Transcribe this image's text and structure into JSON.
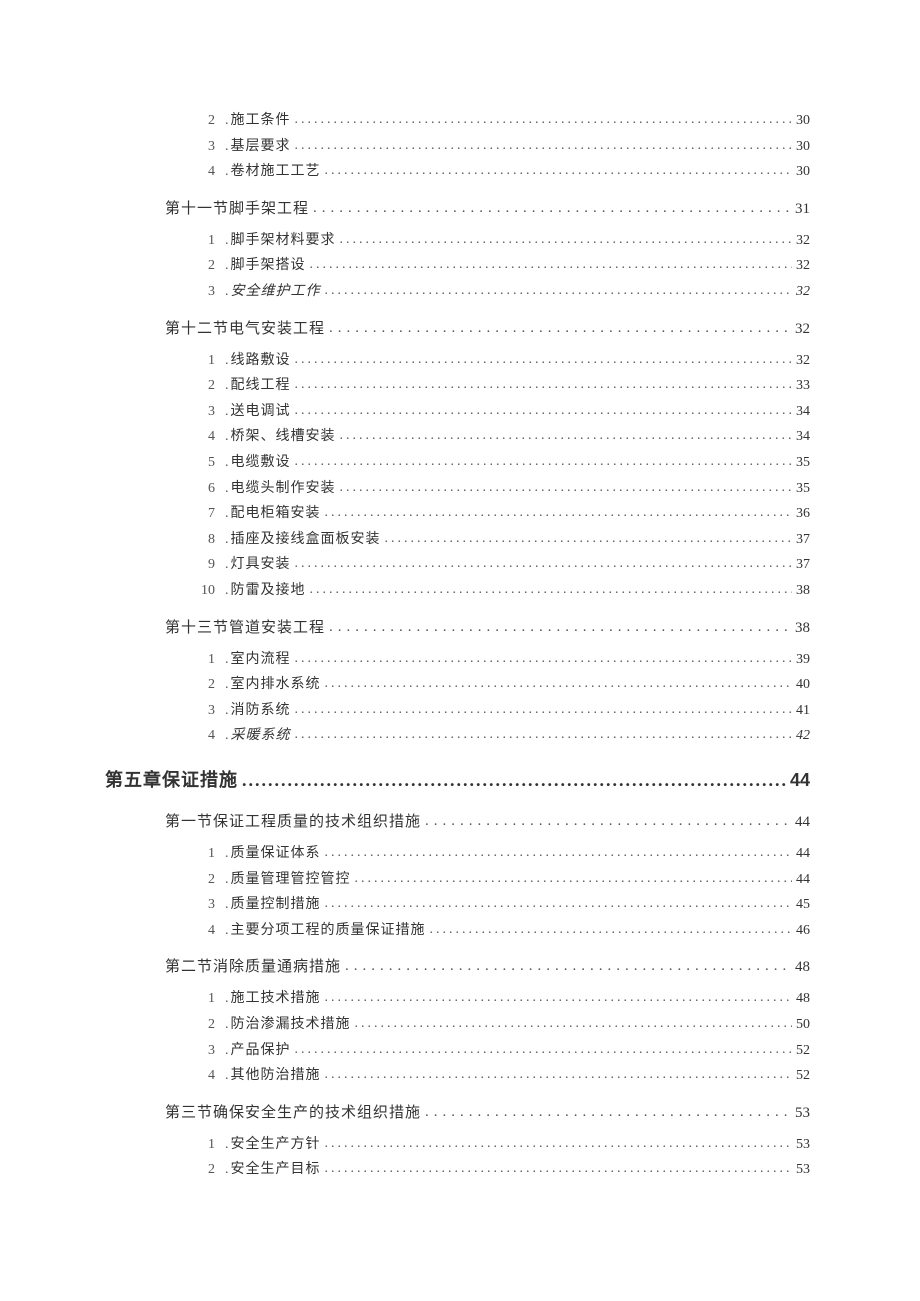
{
  "toc": [
    {
      "level": 3,
      "num": "2",
      "label": "施工条件",
      "page": "30"
    },
    {
      "level": 3,
      "num": "3",
      "label": "基层要求",
      "page": "30"
    },
    {
      "level": 3,
      "num": "4",
      "label": "卷材施工工艺",
      "page": "30"
    },
    {
      "level": 2,
      "label": "第十一节脚手架工程",
      "page": "31"
    },
    {
      "level": 3,
      "num": "1",
      "label": "脚手架材料要求",
      "page": "32"
    },
    {
      "level": 3,
      "num": "2",
      "label": "脚手架搭设",
      "page": "32"
    },
    {
      "level": 3,
      "num": "3",
      "label": "安全维护工作",
      "page": "32",
      "italic": true
    },
    {
      "level": 2,
      "label": "第十二节电气安装工程",
      "page": "32"
    },
    {
      "level": 3,
      "num": "1",
      "label": "线路敷设",
      "page": "32"
    },
    {
      "level": 3,
      "num": "2",
      "label": "配线工程",
      "page": "33"
    },
    {
      "level": 3,
      "num": "3",
      "label": "送电调试",
      "page": "34"
    },
    {
      "level": 3,
      "num": "4",
      "label": "桥架、线槽安装",
      "page": "34"
    },
    {
      "level": 3,
      "num": "5",
      "label": "电缆敷设",
      "page": "35"
    },
    {
      "level": 3,
      "num": "6",
      "label": "电缆头制作安装",
      "page": "35"
    },
    {
      "level": 3,
      "num": "7",
      "label": "配电柜箱安装",
      "page": "36"
    },
    {
      "level": 3,
      "num": "8",
      "label": "插座及接线盒面板安装",
      "page": "37"
    },
    {
      "level": 3,
      "num": "9",
      "label": "灯具安装",
      "page": "37"
    },
    {
      "level": 3,
      "num": "10",
      "label": "防雷及接地",
      "page": "38"
    },
    {
      "level": 2,
      "label": "第十三节管道安装工程",
      "page": "38"
    },
    {
      "level": 3,
      "num": "1",
      "label": "室内流程",
      "page": "39"
    },
    {
      "level": 3,
      "num": "2",
      "label": "室内排水系统",
      "page": "40"
    },
    {
      "level": 3,
      "num": "3",
      "label": "消防系统",
      "page": "41"
    },
    {
      "level": 3,
      "num": "4",
      "label": "采暖系统",
      "page": "42",
      "italic": true
    },
    {
      "level": 1,
      "label": "第五章保证措施",
      "page": "44"
    },
    {
      "level": 2,
      "label": "第一节保证工程质量的技术组织措施",
      "page": "44"
    },
    {
      "level": 3,
      "num": "1",
      "label": "质量保证体系",
      "page": "44"
    },
    {
      "level": 3,
      "num": "2",
      "label": "质量管理管控管控",
      "page": "44"
    },
    {
      "level": 3,
      "num": "3",
      "label": "质量控制措施",
      "page": "45"
    },
    {
      "level": 3,
      "num": "4",
      "label": "主要分项工程的质量保证措施",
      "page": "46"
    },
    {
      "level": 2,
      "label": "第二节消除质量通病措施",
      "page": "48"
    },
    {
      "level": 3,
      "num": "1",
      "label": "施工技术措施",
      "page": "48"
    },
    {
      "level": 3,
      "num": "2",
      "label": "防治渗漏技术措施",
      "page": "50"
    },
    {
      "level": 3,
      "num": "3",
      "label": "产品保护",
      "page": "52"
    },
    {
      "level": 3,
      "num": "4",
      "label": "其他防治措施",
      "page": "52"
    },
    {
      "level": 2,
      "label": "第三节确保安全生产的技术组织措施",
      "page": "53"
    },
    {
      "level": 3,
      "num": "1",
      "label": "安全生产方针",
      "page": "53"
    },
    {
      "level": 3,
      "num": "2",
      "label": "安全生产目标",
      "page": "53"
    }
  ]
}
